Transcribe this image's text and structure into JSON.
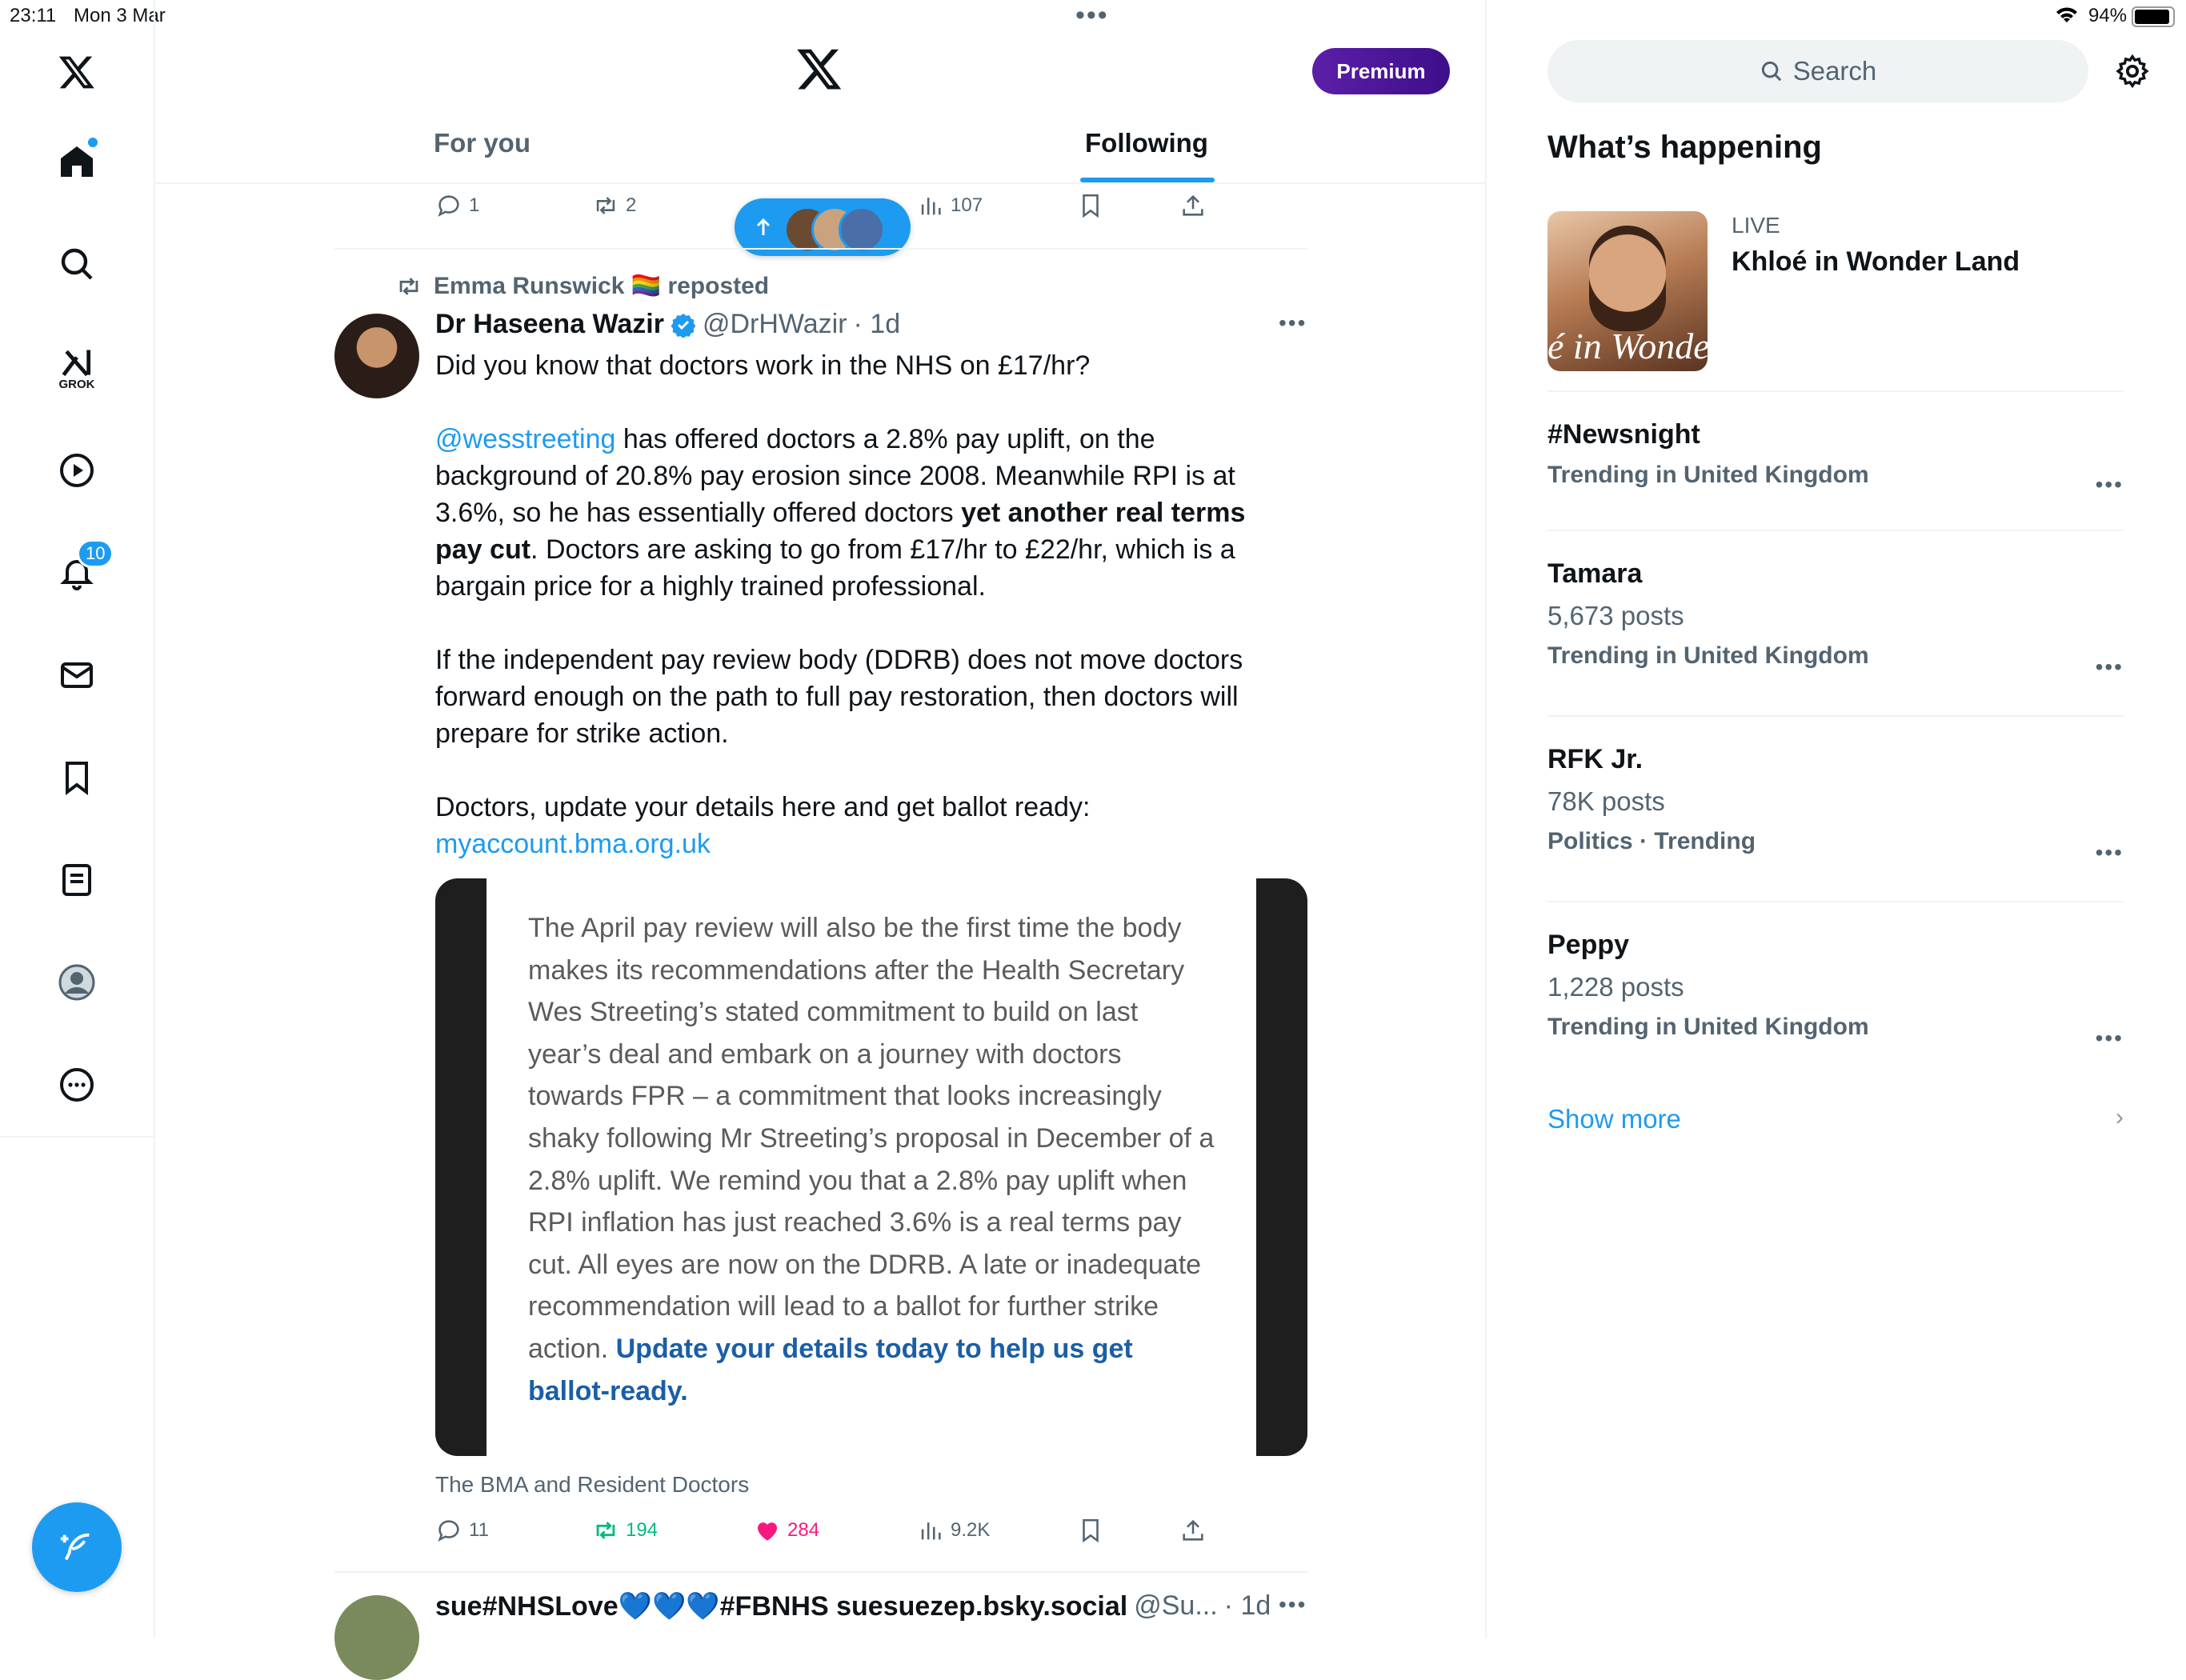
{
  "status": {
    "time": "23:11",
    "date": "Mon 3 Mar",
    "battery": "94%"
  },
  "nav": {
    "grok_label": "GROK",
    "notifications_badge": "10"
  },
  "header": {
    "premium_label": "Premium",
    "tabs": [
      {
        "label": "For you",
        "active": false
      },
      {
        "label": "Following",
        "active": true
      }
    ]
  },
  "prev_tweet_actions": {
    "replies": "1",
    "reposts": "2",
    "views": "107"
  },
  "tweet": {
    "repost_by": "Emma Runswick 🏳️‍🌈 reposted",
    "name": "Dr Haseena Wazir",
    "handle": "@DrHWazir",
    "time": "· 1d",
    "p1": "Did you know that doctors work in the NHS on £17/hr?",
    "mention": "@wesstreeting",
    "p2a": " has offered doctors a 2.8% pay uplift, on the background of 20.8% pay erosion since 2008. Meanwhile RPI is at 3.6%, so he has essentially offered doctors ",
    "p2b": "yet another real terms pay cut",
    "p2c": ". Doctors are asking to go from £17/hr to £22/hr, which is a bargain price for a highly trained professional.",
    "p3": "If the independent pay review body (DDRB) does not move doctors forward enough on the path to full pay restoration, then doctors will prepare for strike action.",
    "p4": "Doctors, update your details here and get ballot ready:",
    "url": "myaccount.bma.org.uk",
    "quote_text": "The April pay review will also be the first time the body makes its recommendations after the Health Secretary Wes Streeting’s stated commitment to build on last year’s deal and embark on a journey with doctors towards FPR – a commitment that looks increasingly shaky following Mr Streeting’s proposal in December of a 2.8% uplift. We remind you that a 2.8% pay uplift when RPI inflation has just reached 3.6% is a real terms pay cut. All eyes are now on the DDRB. A late or inadequate recommendation will lead to a ballot for further strike action. ",
    "quote_link": "Update your details today to help us get ballot-ready.",
    "caption": "The BMA and Resident Doctors",
    "replies": "11",
    "reposts": "194",
    "likes": "284",
    "views": "9.2K"
  },
  "next_tweet": {
    "name": "sue#NHSLove💙💙💙#FBNHS suesuezep.bsky.social",
    "handle": "@Su...",
    "time": "· 1d"
  },
  "sidebar": {
    "search_placeholder": "Search",
    "heading": "What’s happening",
    "live": {
      "label": "LIVE",
      "title": "Khloé in Wonder Land",
      "thumb_text": "é in Wonder I"
    },
    "trends": [
      {
        "name": "#Newsnight",
        "posts": "",
        "context": "Trending in United Kingdom"
      },
      {
        "name": "Tamara",
        "posts": "5,673 posts",
        "context": "Trending in United Kingdom"
      },
      {
        "name": "RFK Jr.",
        "posts": "78K posts",
        "context": "Politics · Trending"
      },
      {
        "name": "Peppy",
        "posts": "1,228 posts",
        "context": "Trending in United Kingdom"
      }
    ],
    "show_more": "Show more"
  },
  "colors": {
    "accent": "#1d9bf0",
    "like": "#f91880",
    "repost": "#00ba7c",
    "premium": "#5b1fa8"
  }
}
